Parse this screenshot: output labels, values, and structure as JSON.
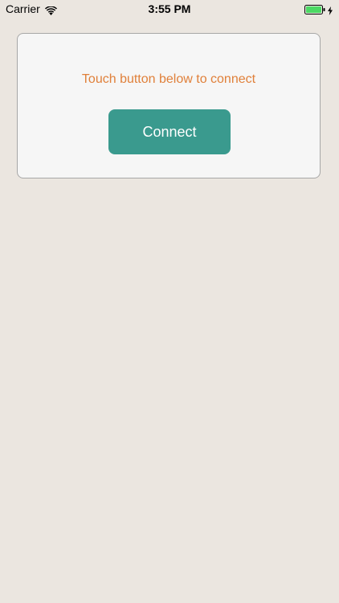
{
  "status_bar": {
    "carrier": "Carrier",
    "time": "3:55 PM",
    "wifi_icon": "wifi-icon",
    "battery_icon": "battery-icon",
    "charge_icon": "charging-bolt-icon"
  },
  "card": {
    "prompt": "Touch button below to connect",
    "button_label": "Connect"
  },
  "colors": {
    "background": "#ebe6e0",
    "card_background": "#f6f6f6",
    "card_border": "#a7a7a7",
    "prompt_text": "#e0803a",
    "button_background": "#3a9a8e",
    "battery_fill": "#4cd964"
  }
}
